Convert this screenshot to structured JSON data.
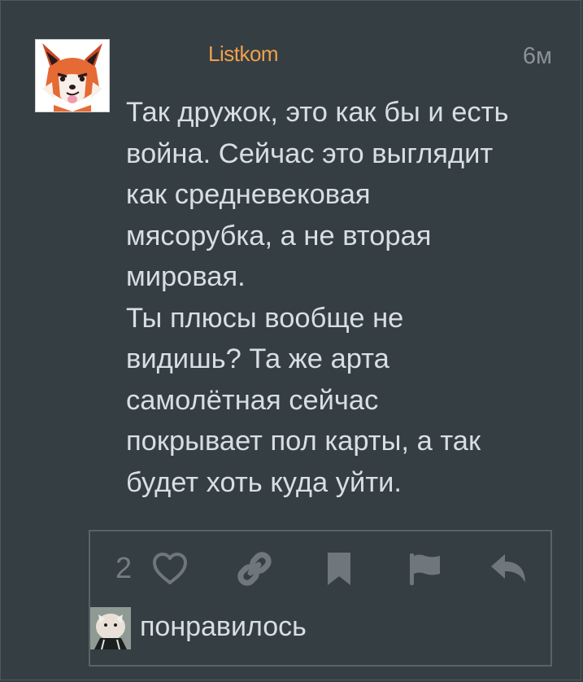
{
  "post": {
    "author": "Listkom",
    "time": "6м",
    "message_lines": [
      "Так дружок, это как бы и есть",
      "война. Сейчас это выглядит",
      "как средневековая",
      "мясорубка, а не вторая",
      "мировая.",
      "Ты плюсы вообще не",
      "видишь? Та же арта",
      "самолётная сейчас",
      "покрывает пол карты, а так",
      "будет хоть куда уйти."
    ]
  },
  "actions": {
    "like_count": "2",
    "icons": [
      "heart-icon",
      "link-icon",
      "bookmark-icon",
      "flag-icon",
      "reply-icon"
    ]
  },
  "likes": {
    "label": "понравилось"
  },
  "colors": {
    "background": "#353e43",
    "author": "#f0a04b",
    "text": "#d8dee1",
    "muted": "#757d81",
    "icon": "#6f777b"
  }
}
